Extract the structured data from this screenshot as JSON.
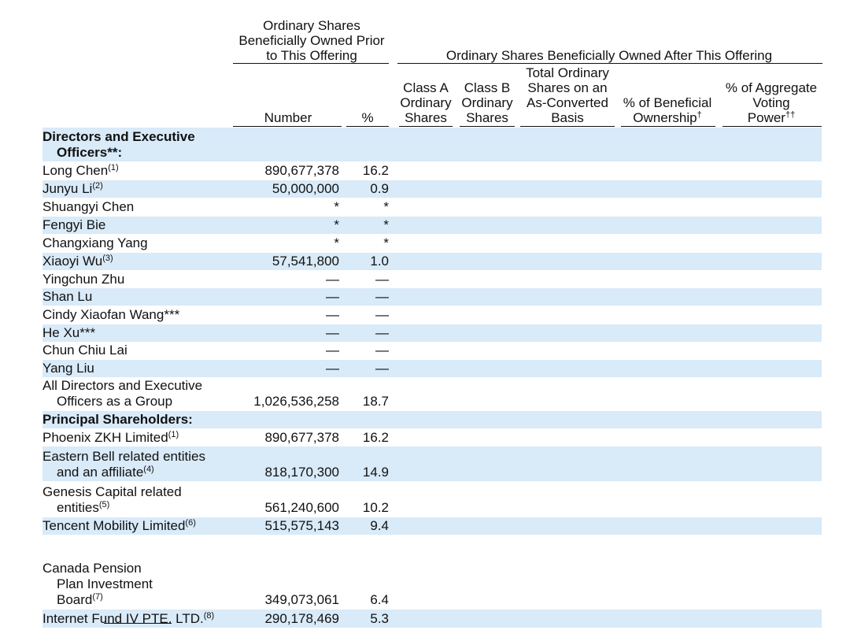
{
  "colors": {
    "band": "#d9eaf8",
    "text": "#111111"
  },
  "header": {
    "prior_group": [
      "Ordinary Shares",
      "Beneficially Owned Prior",
      "to This Offering"
    ],
    "after_group": "Ordinary Shares Beneficially Owned After This Offering",
    "col_number": "Number",
    "col_pct": "%",
    "col_class_a": [
      "Class A",
      "Ordinary",
      "Shares"
    ],
    "col_class_b": [
      "Class B",
      "Ordinary",
      "Shares"
    ],
    "col_total": [
      "Total Ordinary",
      "Shares on an",
      "As-Converted",
      "Basis"
    ],
    "col_beneficial": {
      "text": "% of Beneficial",
      "text2": "Ownership",
      "sup": "†"
    },
    "col_voting": {
      "text": "% of Aggregate",
      "text2": "Voting",
      "text3": "Power",
      "sup": "††"
    }
  },
  "rows": [
    {
      "lines": [
        "Directors and Executive",
        "Officers**:"
      ],
      "bold": true,
      "number": "",
      "pct": "",
      "shaded": true
    },
    {
      "lines": [
        "Long Chen"
      ],
      "sup": "(1)",
      "number": "890,677,378",
      "pct": "16.2",
      "shaded": false
    },
    {
      "lines": [
        "Junyu Li"
      ],
      "sup": "(2)",
      "number": "50,000,000",
      "pct": "0.9",
      "shaded": true
    },
    {
      "lines": [
        "Shuangyi Chen"
      ],
      "number": "*",
      "pct": "*",
      "shaded": false
    },
    {
      "lines": [
        "Fengyi Bie"
      ],
      "number": "*",
      "pct": "*",
      "shaded": true
    },
    {
      "lines": [
        "Changxiang Yang"
      ],
      "number": "*",
      "pct": "*",
      "shaded": false
    },
    {
      "lines": [
        "Xiaoyi Wu"
      ],
      "sup": "(3)",
      "number": "57,541,800",
      "pct": "1.0",
      "shaded": true
    },
    {
      "lines": [
        "Yingchun Zhu"
      ],
      "number": "—",
      "pct": "—",
      "shaded": false
    },
    {
      "lines": [
        "Shan Lu"
      ],
      "number": "—",
      "pct": "—",
      "shaded": true
    },
    {
      "lines": [
        "Cindy Xiaofan Wang***"
      ],
      "number": "—",
      "pct": "—",
      "shaded": false
    },
    {
      "lines": [
        "He Xu***"
      ],
      "number": "—",
      "pct": "—",
      "shaded": true
    },
    {
      "lines": [
        "Chun Chiu Lai"
      ],
      "number": "—",
      "pct": "—",
      "shaded": false
    },
    {
      "lines": [
        "Yang Liu"
      ],
      "number": "—",
      "pct": "—",
      "shaded": true
    },
    {
      "lines": [
        "All Directors and Executive",
        "Officers as a Group"
      ],
      "number": "1,026,536,258",
      "pct": "18.7",
      "shaded": false
    },
    {
      "lines": [
        "Principal Shareholders:"
      ],
      "bold": true,
      "number": "",
      "pct": "",
      "shaded": true
    },
    {
      "lines": [
        "Phoenix ZKH Limited"
      ],
      "sup": "(1)",
      "number": "890,677,378",
      "pct": "16.2",
      "shaded": false
    },
    {
      "lines": [
        "Eastern Bell related entities",
        "and an affiliate"
      ],
      "sup": "(4)",
      "number": "818,170,300",
      "pct": "14.9",
      "shaded": true
    },
    {
      "lines": [
        "Genesis Capital related",
        "entities"
      ],
      "sup": "(5)",
      "number": "561,240,600",
      "pct": "10.2",
      "shaded": false
    },
    {
      "lines": [
        "Tencent Mobility Limited"
      ],
      "sup": "(6)",
      "number": "515,575,143",
      "pct": "9.4",
      "shaded": true
    },
    {
      "lines": [
        "Canada Pension",
        "Plan Investment",
        "Board"
      ],
      "sup": "(7)",
      "number": "349,073,061",
      "pct": "6.4",
      "shaded": false
    },
    {
      "lines": [
        "Internet Fund IV PTE. LTD."
      ],
      "sup": "(8)",
      "number": "290,178,469",
      "pct": "5.3",
      "shaded": true
    }
  ]
}
